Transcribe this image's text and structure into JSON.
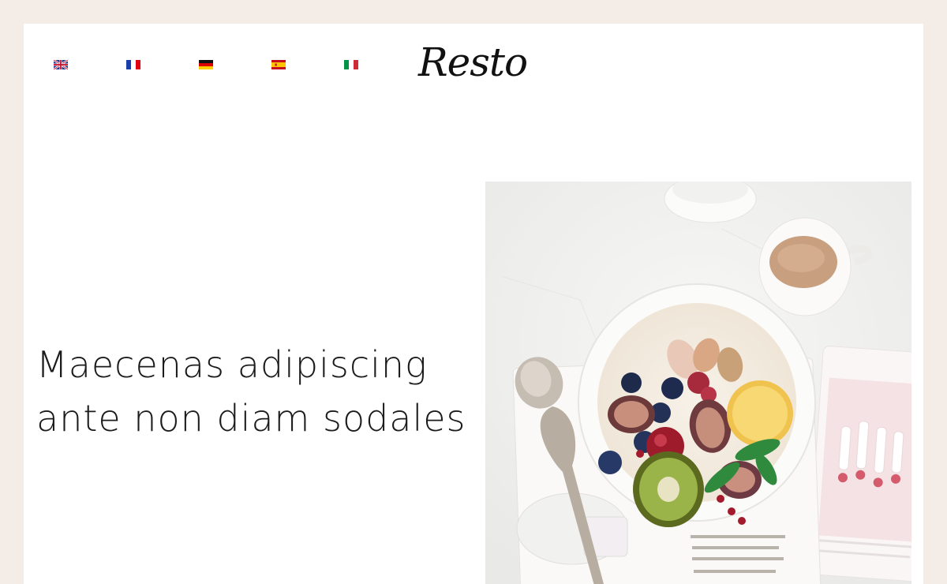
{
  "header": {
    "logo_text": "Resto",
    "languages": [
      {
        "code": "en",
        "flag": "uk-flag-icon"
      },
      {
        "code": "fr",
        "flag": "france-flag-icon"
      },
      {
        "code": "de",
        "flag": "germany-flag-icon"
      },
      {
        "code": "es",
        "flag": "spain-flag-icon"
      },
      {
        "code": "it",
        "flag": "italy-flag-icon"
      }
    ]
  },
  "hero": {
    "title_line1": "Maecenas adipiscing",
    "title_line2": "ante non diam sodales",
    "image": "breakfast-bowl-photo"
  },
  "colors": {
    "page_background": "#f4ede7",
    "content_background": "#ffffff",
    "text": "#1b1b1b"
  }
}
